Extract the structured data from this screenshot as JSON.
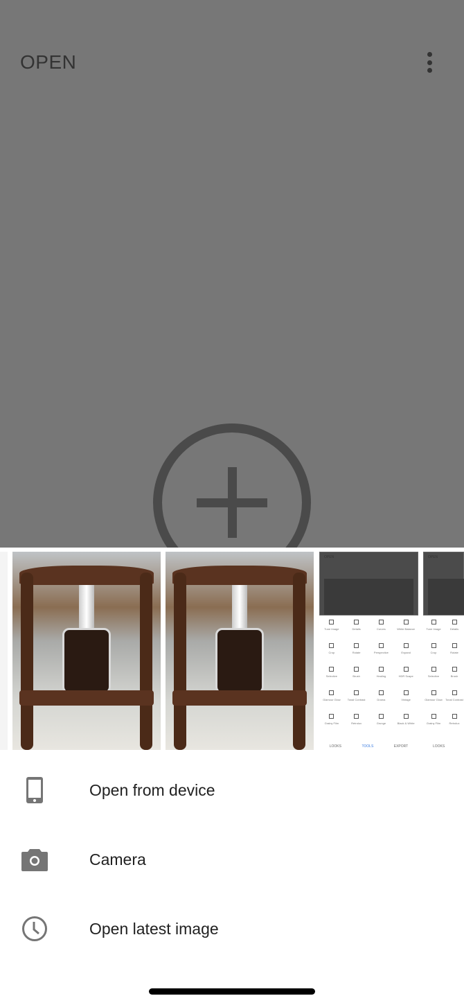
{
  "header": {
    "title": "OPEN",
    "more_icon": "more-vert-icon"
  },
  "main": {
    "add_icon": "add-circle-icon"
  },
  "recent": {
    "items": [
      {
        "type": "photo"
      },
      {
        "type": "photo"
      },
      {
        "type": "screenshot",
        "title": "OPEN",
        "tools": [
          "Tune Image",
          "Details",
          "Curves",
          "White Balance",
          "Crop",
          "Rotate",
          "Perspective",
          "Expand",
          "Selective",
          "Brush",
          "Healing",
          "HDR Scape",
          "Glamour Glow",
          "Tonal Contrast",
          "Drama",
          "Vintage",
          "Grainy Film",
          "Retrolux",
          "Grunge",
          "Black & White"
        ],
        "tabs": [
          "LOOKS",
          "TOOLS",
          "EXPORT"
        ],
        "active_tab": "TOOLS"
      },
      {
        "type": "screenshot",
        "title": "OPEN",
        "tools": [
          "Tune Image",
          "Details",
          "Crop",
          "Rotate",
          "Selective",
          "Brush",
          "Glamour Glow",
          "Tonal Contrast",
          "Grainy Film",
          "Retrolux"
        ],
        "tabs": [
          "LOOKS"
        ]
      }
    ]
  },
  "menu": [
    {
      "label": "Open from device",
      "icon": "smartphone-icon"
    },
    {
      "label": "Camera",
      "icon": "camera-icon"
    },
    {
      "label": "Open latest image",
      "icon": "clock-icon"
    }
  ],
  "colors": {
    "overlay": "#777777",
    "text": "#212121",
    "icon": "#757575",
    "accent": "#3a7be0"
  }
}
